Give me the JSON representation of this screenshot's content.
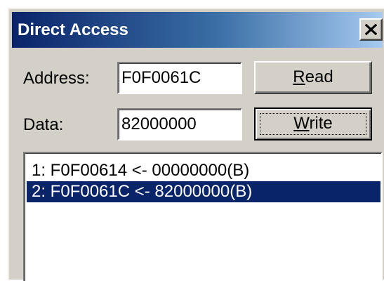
{
  "window": {
    "title": "Direct Access"
  },
  "address": {
    "label": "Address:",
    "value": "F0F0061C"
  },
  "data_field": {
    "label": "Data:",
    "value": "82000000"
  },
  "buttons": {
    "read_underline": "R",
    "read_rest": "ead",
    "write_underline": "W",
    "write_rest": "rite"
  },
  "log": {
    "items": [
      {
        "text": "1: F0F00614 <- 00000000(B)",
        "selected": false
      },
      {
        "text": "2: F0F0061C <- 82000000(B)",
        "selected": true
      }
    ]
  },
  "colors": {
    "title_start": "#0a246a",
    "title_end": "#a6caf0",
    "selection": "#0a246a",
    "face": "#d4d0c8"
  },
  "icons": {
    "close": "close-icon"
  }
}
